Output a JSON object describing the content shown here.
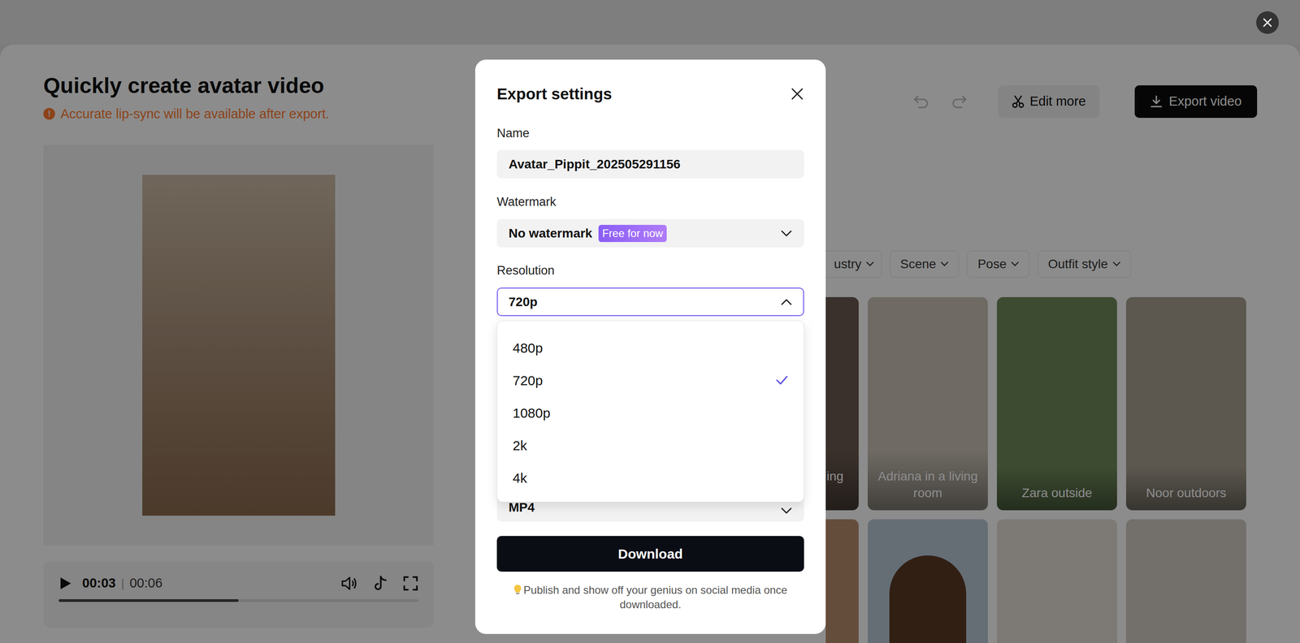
{
  "page": {
    "title": "Quickly create avatar video",
    "warning_icon": "!",
    "warning": "Accurate lip-sync will be available after export."
  },
  "player": {
    "current": "00:03",
    "separator": "|",
    "duration": "00:06",
    "level": 0.5
  },
  "toolbar": {
    "edit_more": "Edit more",
    "export": "Export video"
  },
  "filters": [
    "ustry",
    "Scene",
    "Pose",
    "Outfit style"
  ],
  "avatars": [
    {
      "label": "ing"
    },
    {
      "label": "Adriana in a living room"
    },
    {
      "label": "Zara outside"
    },
    {
      "label": "Noor outdoors"
    }
  ],
  "modal": {
    "title": "Export settings",
    "name": {
      "label": "Name",
      "value": "Avatar_Pippit_202505291156"
    },
    "watermark": {
      "label": "Watermark",
      "value": "No watermark",
      "badge": "Free for now"
    },
    "resolution": {
      "label": "Resolution",
      "value": "720p",
      "expanded": true,
      "options": [
        {
          "label": "480p",
          "selected": false
        },
        {
          "label": "720p",
          "selected": true
        },
        {
          "label": "1080p",
          "selected": false
        },
        {
          "label": "2k",
          "selected": false
        },
        {
          "label": "4k",
          "selected": false
        }
      ]
    },
    "format": {
      "value": "MP4"
    },
    "download": "Download",
    "footer": "Publish and show off your genius on social media once downloaded."
  }
}
